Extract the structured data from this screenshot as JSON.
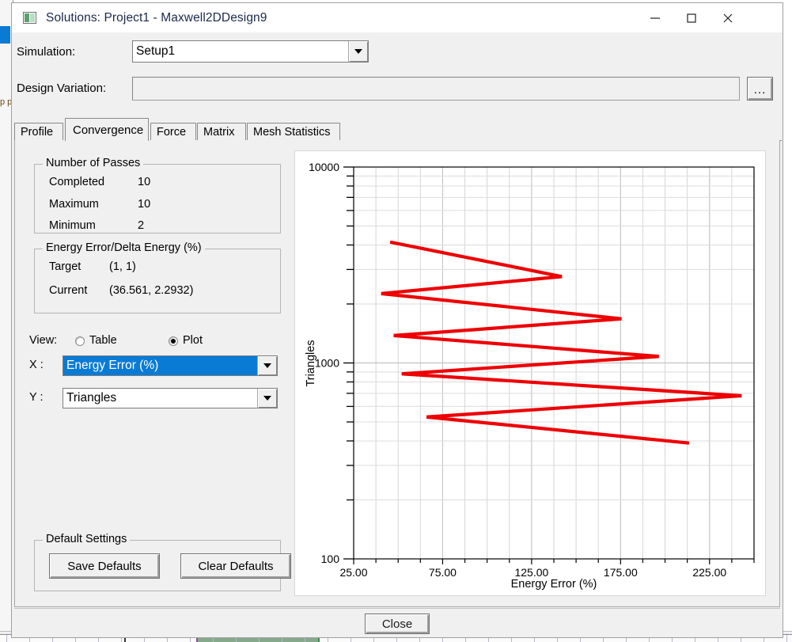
{
  "window": {
    "title": "Solutions: Project1 - Maxwell2DDesign9",
    "icon": "application-icon",
    "controls": {
      "minimize": "minimize-icon",
      "maximize": "maximize-icon",
      "close": "close-icon"
    }
  },
  "form": {
    "simulation_label": "Simulation:",
    "simulation_value": "Setup1",
    "design_variation_label": "Design Variation:",
    "design_variation_value": "",
    "browse_label": "..."
  },
  "tabs": [
    {
      "label": "Profile",
      "active": false
    },
    {
      "label": "Convergence",
      "active": true
    },
    {
      "label": "Force",
      "active": false
    },
    {
      "label": "Matrix",
      "active": false
    },
    {
      "label": "Mesh Statistics",
      "active": false
    }
  ],
  "passes": {
    "legend": "Number of Passes",
    "rows": [
      {
        "label": "Completed",
        "value": "10"
      },
      {
        "label": "Maximum",
        "value": "10"
      },
      {
        "label": "Minimum",
        "value": "2"
      }
    ]
  },
  "energy": {
    "legend": "Energy Error/Delta Energy (%)",
    "rows": [
      {
        "label": "Target",
        "value": "(1, 1)"
      },
      {
        "label": "Current",
        "value": "(36.561, 2.2932)"
      }
    ]
  },
  "view": {
    "label": "View:",
    "options": [
      {
        "label": "Table",
        "selected": false
      },
      {
        "label": "Plot",
        "selected": true
      }
    ]
  },
  "axes_select": {
    "x_label": "X :",
    "x_value": "Energy Error (%)",
    "y_label": "Y :",
    "y_value": "Triangles"
  },
  "defaults": {
    "legend": "Default Settings",
    "save_label": "Save Defaults",
    "clear_label": "Clear Defaults"
  },
  "footer": {
    "close_label": "Close"
  },
  "colors": {
    "accent": "#0a7bd5",
    "series": "#ee0000",
    "dialog_bg": "#f0f0f0",
    "grid": "#d0d0d0",
    "axis": "#000000"
  },
  "chart_data": {
    "type": "line",
    "title": "",
    "xlabel": "Energy Error (%)",
    "ylabel": "Triangles",
    "xlim": [
      25,
      250
    ],
    "ylim": [
      100,
      10000
    ],
    "yscale": "log",
    "xscale": "linear",
    "grid": true,
    "legend": null,
    "xticks": [
      25.0,
      75.0,
      125.0,
      175.0,
      225.0
    ],
    "xticklabels": [
      "25.00",
      "75.00",
      "125.00",
      "175.00",
      "225.00"
    ],
    "xminor_step": 12.5,
    "yticks": [
      100,
      1000,
      10000
    ],
    "yticklabels": [
      "100",
      "1000",
      "10000"
    ],
    "series": [
      {
        "name": "Convergence",
        "color": "#ee0000",
        "x": [
          45.5,
          142.0,
          40.5,
          175.5,
          47.5,
          196.5,
          52.0,
          243.0,
          66.0,
          213.5
        ],
        "y": [
          4140,
          2760,
          2260,
          1680,
          1380,
          1080,
          880,
          680,
          530,
          390
        ]
      }
    ],
    "points_note": "Single zig-zag polyline read in plot order: pass values alternate decreasing triangle count with sawtooth energy error"
  },
  "background_app": {
    "tree_text": "p p n t c c r v v y"
  }
}
